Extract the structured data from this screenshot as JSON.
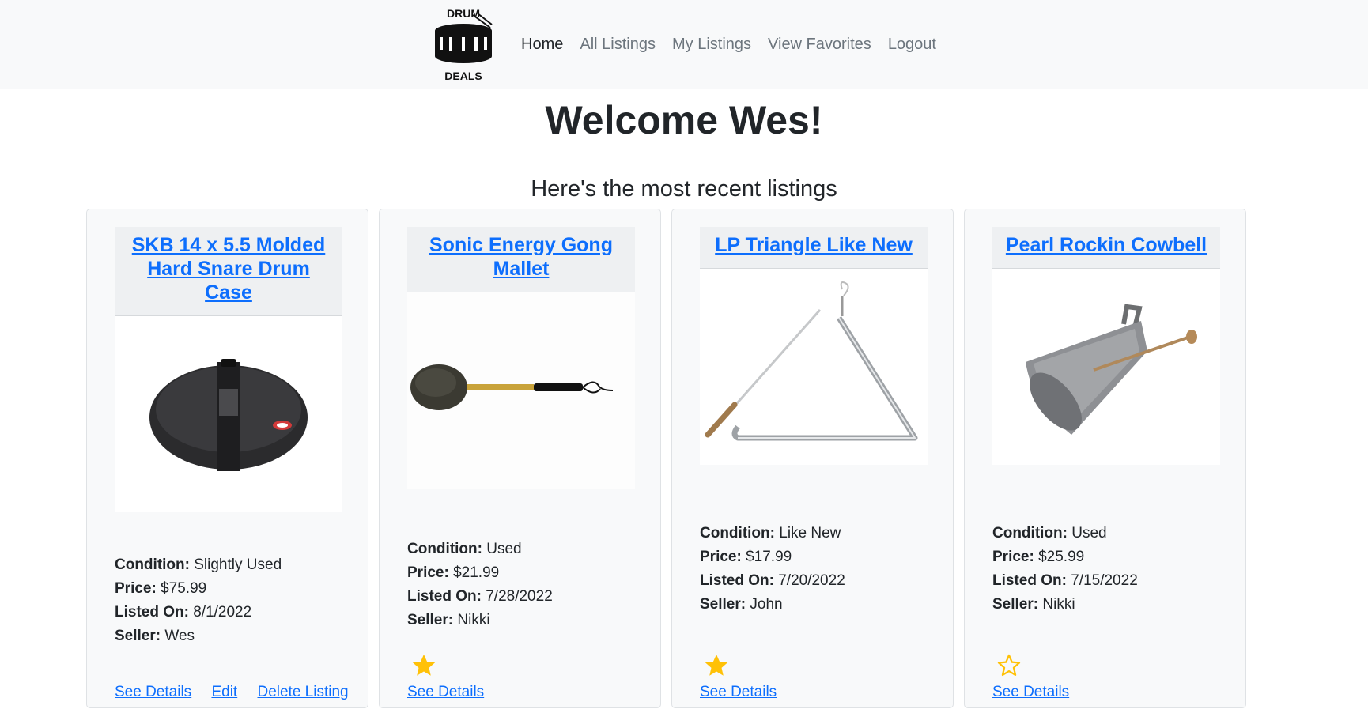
{
  "nav": {
    "logo_top": "DRUM",
    "logo_bottom": "DEALS",
    "links": [
      "Home",
      "All Listings",
      "My Listings",
      "View Favorites",
      "Logout"
    ]
  },
  "welcome": "Welcome Wes!",
  "subheading": "Here's the most recent listings",
  "labels": {
    "condition": "Condition:",
    "price": "Price:",
    "listed_on": "Listed On:",
    "seller": "Seller:"
  },
  "listings": [
    {
      "title": "SKB 14 x 5.5 Molded Hard Snare Drum Case",
      "condition": "Slightly Used",
      "price": "$75.99",
      "listed_on": "8/1/2022",
      "seller": "Wes",
      "favorite": null,
      "actions": [
        "See Details",
        "Edit",
        "Delete Listing"
      ],
      "image_icon": "snare-case-image"
    },
    {
      "title": "Sonic Energy Gong Mallet",
      "condition": "Used",
      "price": "$21.99",
      "listed_on": "7/28/2022",
      "seller": "Nikki",
      "favorite": "filled",
      "actions": [
        "See Details"
      ],
      "image_icon": "gong-mallet-image"
    },
    {
      "title": "LP Triangle Like New",
      "condition": "Like New",
      "price": "$17.99",
      "listed_on": "7/20/2022",
      "seller": "John",
      "favorite": "filled",
      "actions": [
        "See Details"
      ],
      "image_icon": "triangle-image"
    },
    {
      "title": "Pearl Rockin Cowbell",
      "condition": "Used",
      "price": "$25.99",
      "listed_on": "7/15/2022",
      "seller": "Nikki",
      "favorite": "outline",
      "actions": [
        "See Details"
      ],
      "image_icon": "cowbell-image"
    }
  ],
  "colors": {
    "link": "#0d6efd",
    "star": "#ffc107",
    "navbar_bg": "#f8f9fa"
  }
}
